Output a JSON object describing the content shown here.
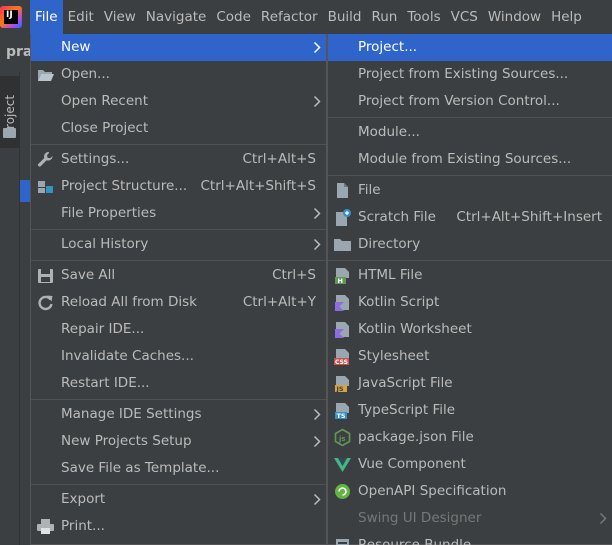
{
  "menubar": {
    "items": [
      {
        "label": "File",
        "active": true
      },
      {
        "label": "Edit"
      },
      {
        "label": "View"
      },
      {
        "label": "Navigate"
      },
      {
        "label": "Code"
      },
      {
        "label": "Refactor"
      },
      {
        "label": "Build"
      },
      {
        "label": "Run"
      },
      {
        "label": "Tools"
      },
      {
        "label": "VCS"
      },
      {
        "label": "Window"
      },
      {
        "label": "Help"
      }
    ]
  },
  "background": {
    "project_name_partial": "pra",
    "project_tab_label": "Project"
  },
  "file_menu": {
    "items": [
      {
        "label": "New",
        "submenu": true
      },
      {
        "label": "Open...",
        "icon": "folder-open-icon"
      },
      {
        "label": "Open Recent",
        "submenu": true
      },
      {
        "label": "Close Project"
      },
      {
        "label": "Settings...",
        "shortcut": "Ctrl+Alt+S",
        "icon": "wrench-icon"
      },
      {
        "label": "Project Structure...",
        "shortcut": "Ctrl+Alt+Shift+S",
        "icon": "project-structure-icon"
      },
      {
        "label": "File Properties",
        "submenu": true
      },
      {
        "label": "Local History",
        "submenu": true
      },
      {
        "label": "Save All",
        "shortcut": "Ctrl+S",
        "icon": "save-icon"
      },
      {
        "label": "Reload All from Disk",
        "shortcut": "Ctrl+Alt+Y",
        "icon": "reload-icon"
      },
      {
        "label": "Repair IDE..."
      },
      {
        "label": "Invalidate Caches..."
      },
      {
        "label": "Restart IDE..."
      },
      {
        "label": "Manage IDE Settings",
        "submenu": true
      },
      {
        "label": "New Projects Setup",
        "submenu": true
      },
      {
        "label": "Save File as Template..."
      },
      {
        "label": "Export",
        "submenu": true
      },
      {
        "label": "Print...",
        "icon": "print-icon"
      }
    ]
  },
  "new_submenu": {
    "items": [
      {
        "label": "Project..."
      },
      {
        "label": "Project from Existing Sources..."
      },
      {
        "label": "Project from Version Control..."
      },
      {
        "label": "Module..."
      },
      {
        "label": "Module from Existing Sources..."
      },
      {
        "label": "File",
        "icon": "file-icon"
      },
      {
        "label": "Scratch File",
        "shortcut": "Ctrl+Alt+Shift+Insert",
        "icon": "scratch-file-icon"
      },
      {
        "label": "Directory",
        "icon": "directory-icon"
      },
      {
        "label": "HTML File",
        "icon": "html-file-icon",
        "badge": "H"
      },
      {
        "label": "Kotlin Script",
        "icon": "kotlin-script-icon"
      },
      {
        "label": "Kotlin Worksheet",
        "icon": "kotlin-worksheet-icon"
      },
      {
        "label": "Stylesheet",
        "icon": "css-file-icon",
        "badge": "CSS"
      },
      {
        "label": "JavaScript File",
        "icon": "javascript-file-icon",
        "badge": "JS"
      },
      {
        "label": "TypeScript File",
        "icon": "typescript-file-icon",
        "badge": "TS"
      },
      {
        "label": "package.json File",
        "icon": "nodejs-icon"
      },
      {
        "label": "Vue Component",
        "icon": "vue-icon"
      },
      {
        "label": "OpenAPI Specification",
        "icon": "openapi-icon"
      },
      {
        "label": "Swing UI Designer",
        "disabled": true,
        "submenu": true
      },
      {
        "label": "Resource Bundle",
        "icon": "resource-bundle-icon"
      }
    ]
  },
  "colors": {
    "menu_bg": "#3c3f41",
    "highlight": "#2f65ca",
    "text": "#bbbbbb",
    "disabled_text": "#777777",
    "separator": "#515151"
  }
}
